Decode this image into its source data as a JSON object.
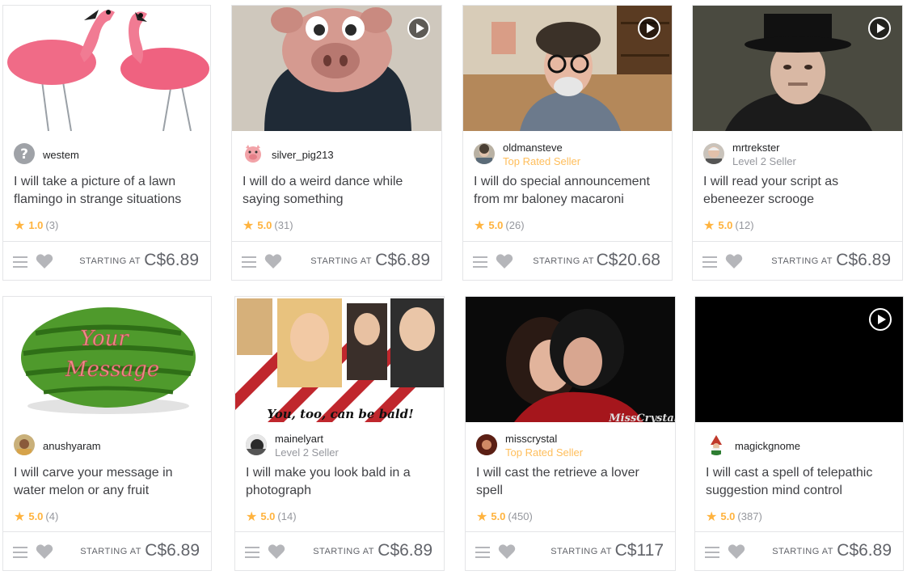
{
  "price_label": "STARTING AT",
  "colors": {
    "accent_star": "#ffb33e",
    "top_rated": "#ffbe5b",
    "muted": "#95979d",
    "border": "#e4e5e7"
  },
  "gigs": [
    {
      "seller": "westem",
      "level": "",
      "title": "I will take a picture of a lawn flamingo in strange situations",
      "rating": "1.0",
      "reviews": "(3)",
      "price": "C$6.89",
      "has_video": false,
      "avatar_icon": "question-mark-icon"
    },
    {
      "seller": "silver_pig213",
      "level": "",
      "title": "I will do a weird dance while saying something",
      "rating": "5.0",
      "reviews": "(31)",
      "price": "C$6.89",
      "has_video": true,
      "avatar_icon": "pig-icon"
    },
    {
      "seller": "oldmansteve",
      "level": "Top Rated Seller",
      "title": "I will do special announcement from mr baloney macaroni",
      "rating": "5.0",
      "reviews": "(26)",
      "price": "C$20.68",
      "has_video": true,
      "avatar_icon": "user-avatar"
    },
    {
      "seller": "mrtrekster",
      "level": "Level 2 Seller",
      "title": "I will read your script as ebeneezer scrooge",
      "rating": "5.0",
      "reviews": "(12)",
      "price": "C$6.89",
      "has_video": true,
      "avatar_icon": "user-avatar"
    },
    {
      "seller": "anushyaram",
      "level": "",
      "title": "I will carve your message in water melon or any fruit",
      "rating": "5.0",
      "reviews": "(4)",
      "price": "C$6.89",
      "has_video": false,
      "avatar_icon": "user-avatar"
    },
    {
      "seller": "mainelyart",
      "level": "Level 2 Seller",
      "title": "I will make you look bald in a photograph",
      "rating": "5.0",
      "reviews": "(14)",
      "price": "C$6.89",
      "has_video": false,
      "avatar_icon": "user-avatar"
    },
    {
      "seller": "misscrystal",
      "level": "Top Rated Seller",
      "title": "I will cast the retrieve a lover spell",
      "rating": "5.0",
      "reviews": "(450)",
      "price": "C$117",
      "has_video": false,
      "avatar_icon": "user-avatar"
    },
    {
      "seller": "magickgnome",
      "level": "",
      "title": "I will cast a spell of telepathic suggestion mind control",
      "rating": "5.0",
      "reviews": "(387)",
      "price": "C$6.89",
      "has_video": true,
      "avatar_icon": "gnome-icon"
    }
  ],
  "thumb_text": {
    "watermelon_line1": "Your",
    "watermelon_line2": "Message",
    "bald_caption": "You, too, can be bald!",
    "crystal_watermark": "MissCrystal"
  }
}
